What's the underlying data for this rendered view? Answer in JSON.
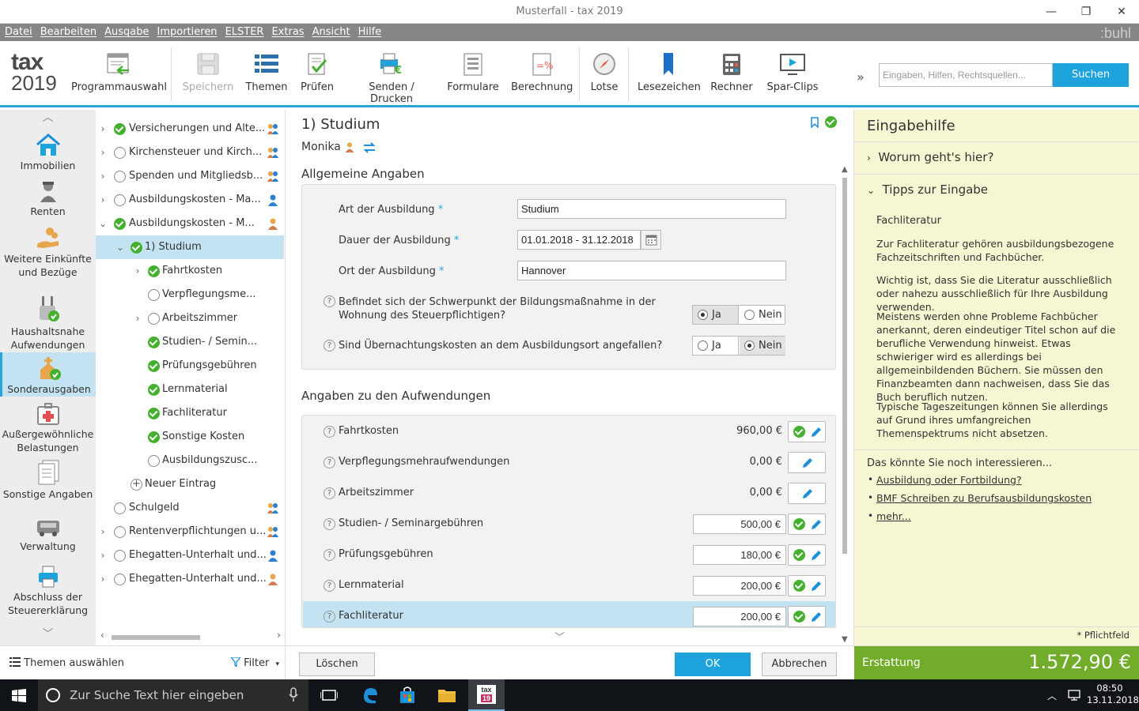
{
  "window": {
    "title": "Musterfall - tax 2019",
    "minimize": "—",
    "maximize": "❐",
    "close": "✕"
  },
  "menu": {
    "items": [
      "Datei",
      "Bearbeiten",
      "Ausgabe",
      "Importieren",
      "ELSTER",
      "Extras",
      "Ansicht",
      "Hilfe"
    ],
    "brand": ":buhl"
  },
  "logo": {
    "line1": "tax",
    "line2": "2019"
  },
  "toolbar": {
    "programmauswahl": "Programmauswahl",
    "speichern": "Speichern",
    "themen": "Themen",
    "pruefen": "Prüfen",
    "senden": "Senden / Drucken",
    "formulare": "Formulare",
    "berechnung": "Berechnung",
    "lotse": "Lotse",
    "lesezeichen": "Lesezeichen",
    "rechner": "Rechner",
    "sparclips": "Spar-Clips",
    "more": "»",
    "search_placeholder": "Eingaben, Hilfen, Rechtsquellen...",
    "search_button": "Suchen"
  },
  "nav": {
    "immobilien": "Immobilien",
    "renten": "Renten",
    "weitere": "Weitere Einkünfte und Bezüge",
    "haushalt": "Haushaltsnahe Aufwendungen",
    "sonder": "Sonderausgaben",
    "aussergew": "Außergewöhnliche Belastungen",
    "sonstige": "Sonstige Angaben",
    "verwaltung": "Verwaltung",
    "abschluss": "Abschluss der Steuererklärung"
  },
  "tree": {
    "items": [
      "Versicherungen und Alte...",
      "Kirchensteuer und Kirch...",
      "Spenden und Mitgliedsb...",
      "Ausbildungskosten - Ma...",
      "Ausbildungskosten - M...",
      "1) Studium",
      "Fahrtkosten",
      "Verpflegungsme...",
      "Arbeitszimmer",
      "Studien- / Semin...",
      "Prüfungsgebühren",
      "Lernmaterial",
      "Fachliteratur",
      "Sonstige Kosten",
      "Ausbildungszusc...",
      "Neuer Eintrag",
      "Schulgeld",
      "Rentenverpflichtungen u...",
      "Ehegatten-Unterhalt und...",
      "Ehegatten-Unterhalt und..."
    ]
  },
  "main": {
    "title": "1) Studium",
    "person": "Monika",
    "section1": "Allgemeine Angaben",
    "art_label": "Art der Ausbildung",
    "art_value": "Studium",
    "dauer_label": "Dauer der Ausbildung",
    "dauer_value": "01.01.2018 - 31.12.2018",
    "ort_label": "Ort der Ausbildung",
    "ort_value": "Hannover",
    "req": "*",
    "q1": "Befindet sich der Schwerpunkt der Bildungsmaßnahme in der Wohnung des Steuerpflichtigen?",
    "q2": "Sind Übernachtungskosten an dem Ausbildungsort angefallen?",
    "ja": "Ja",
    "nein": "Nein",
    "section2": "Angaben zu den Aufwendungen",
    "rows": [
      {
        "label": "Fahrtkosten",
        "value": "960,00 €"
      },
      {
        "label": "Verpflegungsmehraufwendungen",
        "value": "0,00 €"
      },
      {
        "label": "Arbeitszimmer",
        "value": "0,00 €"
      },
      {
        "label": "Studien- / Seminargebühren",
        "value": "500,00 €"
      },
      {
        "label": "Prüfungsgebühren",
        "value": "180,00 €"
      },
      {
        "label": "Lernmaterial",
        "value": "200,00 €"
      },
      {
        "label": "Fachliteratur",
        "value": "200,00 €"
      }
    ]
  },
  "help": {
    "title": "Eingabehilfe",
    "acc1": "Worum geht's hier?",
    "acc2": "Tipps zur Eingabe",
    "subtitle": "Fachliteratur",
    "p1": "Zur Fachliteratur gehören ausbildungsbezogene Fachzeitschriften und Fachbücher.",
    "p2": "Wichtig ist, dass Sie die Literatur ausschließlich oder nahezu ausschließlich für Ihre Ausbildung verwenden.",
    "p3": "Meistens werden ohne Probleme Fachbücher anerkannt, deren eindeutiger Titel schon auf die berufliche Verwendung hinweist. Etwas schwieriger wird es allerdings bei allgemeinbildenden Büchern. Sie müssen den Finanzbeamten dann nachweisen, dass Sie das Buch beruflich nutzen.",
    "p4": "Typische Tageszeitungen können Sie allerdings auf Grund ihres umfangreichen Themenspektrums nicht absetzen.",
    "interest": "Das könnte Sie noch interessieren...",
    "link1": "Ausbildung oder Fortbildung?",
    "link2": "BMF Schreiben zu Berufsausbildungskosten",
    "link3": "mehr...",
    "pflicht": "* Pflichtfeld"
  },
  "bottom": {
    "themen": "Themen auswählen",
    "filter": "Filter",
    "loeschen": "Löschen",
    "ok": "OK",
    "abbrechen": "Abbrechen",
    "erstattung_label": "Erstattung",
    "erstattung_value": "1.572,90 €"
  },
  "taskbar": {
    "search": "Zur Suche Text hier eingeben",
    "time": "08:50",
    "date": "13.11.2018"
  }
}
